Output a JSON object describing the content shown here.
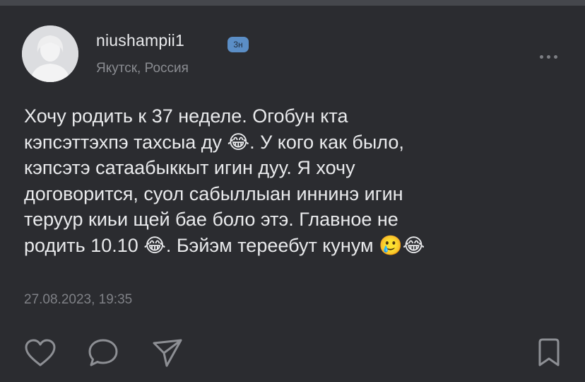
{
  "post": {
    "author": "niushampii1",
    "badge": "3н",
    "location": "Якутск, Россия",
    "text": "Хочу родить к 37 неделе. Огобун кта\nкэпсэттэхпэ тахсыа ду 😂. У кого как было,\nкэпсэтэ сатаабыккыт игин дуу. Я хочу\nдоговорится, суол сабыллыан иннинэ игин\nтеруур киьи щей бае боло этэ. Главное не\nродить 10.10 😂. Бэйэм тереебут кунум 🥲😂",
    "date": "27.08.2023, 19:35"
  },
  "icons": {
    "avatar": "user-silhouette",
    "more": "ellipsis-icon",
    "like": "heart-icon",
    "comment": "comment-bubble-icon",
    "share": "paper-plane-icon",
    "bookmark": "bookmark-icon"
  },
  "colors": {
    "background": "#2b2c30",
    "text": "#e9eaec",
    "secondary_text": "#8a8c91",
    "badge": "#5b8ec6",
    "icon": "#8d8f94"
  }
}
